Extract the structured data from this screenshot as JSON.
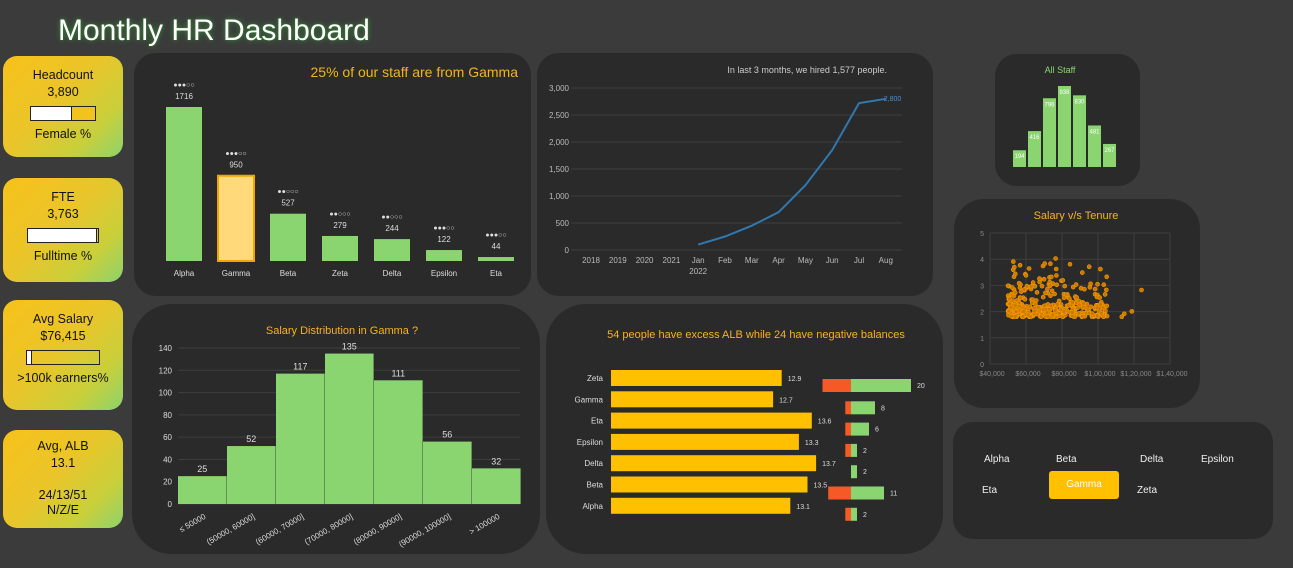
{
  "title": "Monthly HR Dashboard",
  "kpis": {
    "headcount": {
      "label": "Headcount",
      "value": "3,890",
      "sub": "Female %",
      "bar_fraction": 0.62
    },
    "fte": {
      "label": "FTE",
      "value": "3,763",
      "sub": "Fulltime %",
      "bar_fraction": 0.97
    },
    "salary": {
      "label": "Avg Salary",
      "value": "$76,415",
      "sub": ">100k earners%",
      "bar_fraction": 0.06
    },
    "alb": {
      "label": "Avg, ALB",
      "value": "13.1",
      "ratio": "24/13/51",
      "ratio_sub": "N/Z/E"
    }
  },
  "colors": {
    "green": "#8ad56f",
    "yellow": "#ffc000",
    "orange": "#f55a26",
    "highlight": "#ffd97a",
    "panel": "#2a2a2a",
    "blue": "#2f78b0"
  },
  "chart_data": [
    {
      "id": "dept",
      "type": "bar",
      "title": "25% of our staff are from Gamma",
      "categories": [
        "Alpha",
        "Gamma",
        "Beta",
        "Zeta",
        "Delta",
        "Epsilon",
        "Eta"
      ],
      "values": [
        1716,
        950,
        527,
        279,
        244,
        122,
        44
      ],
      "value_labels": [
        "1716",
        "950",
        "527",
        "279",
        "244",
        "122",
        "44"
      ],
      "rating_labels": [
        "●●●○○",
        "●●●○○",
        "●●○○○",
        "●●○○○",
        "●●○○○",
        "●●●○○",
        "●●●○○"
      ],
      "highlight": "Gamma"
    },
    {
      "id": "hires",
      "type": "line",
      "title": "In last 3 months, we hired 1,577 people.",
      "x": [
        "2018",
        "2019",
        "2020",
        "2021",
        "Jan 2022",
        "Feb",
        "Mar",
        "Apr",
        "May",
        "Jun",
        "Jul",
        "Aug"
      ],
      "x_ticks": [
        "2018",
        "2019",
        "2020",
        "2021",
        "Jan",
        "Feb",
        "Mar",
        "Apr",
        "May",
        "Jun",
        "Jul",
        "Aug"
      ],
      "x_sub": "2022",
      "y": [
        null,
        null,
        null,
        null,
        100,
        250,
        450,
        700,
        1200,
        1850,
        2720,
        2800
      ],
      "end_label": "2,800",
      "yticks": [
        "3,000",
        "2,500",
        "2,000",
        "1,500",
        "1,000",
        "500",
        "0"
      ],
      "ylim": [
        0,
        3000
      ]
    },
    {
      "id": "allstaff",
      "type": "bar",
      "title": "All Staff",
      "values": [
        194,
        416,
        796,
        938,
        830,
        481,
        267
      ]
    },
    {
      "id": "scatter",
      "type": "scatter",
      "title": "Salary v/s Tenure",
      "xticks": [
        "$40,000",
        "$60,000",
        "$80,000",
        "$1,00,000",
        "$1,20,000",
        "$1,40,000"
      ],
      "yticks": [
        "5",
        "4",
        "3",
        "2",
        "1",
        "0"
      ],
      "xlim": [
        40000,
        140000
      ],
      "ylim": [
        0,
        5
      ]
    },
    {
      "id": "salarydist",
      "type": "bar",
      "title": "Salary Distribution in Gamma ?",
      "categories": [
        "≤ 50000",
        "(50000, 60000]",
        "(60000, 70000]",
        "(70000, 80000]",
        "(80000, 90000]",
        "(90000, 100000]",
        "> 100000"
      ],
      "values": [
        25,
        52,
        117,
        135,
        111,
        56,
        32
      ],
      "yticks": [
        "140",
        "120",
        "100",
        "80",
        "60",
        "40",
        "20",
        "0"
      ],
      "ylim": [
        0,
        140
      ]
    },
    {
      "id": "alb",
      "type": "bar",
      "title": "54 people have excess ALB while 24 have negative balances",
      "categories": [
        "Zeta",
        "Gamma",
        "Eta",
        "Epsilon",
        "Delta",
        "Beta",
        "Alpha"
      ],
      "values": [
        12.9,
        12.7,
        13.6,
        13.3,
        13.7,
        13.5,
        13.1
      ],
      "excess": [
        20,
        8,
        6,
        2,
        2,
        11,
        2
      ],
      "negative": [
        5,
        1,
        1,
        1,
        0,
        4,
        1
      ]
    }
  ],
  "slicer": {
    "items": [
      "Alpha",
      "Beta",
      "Delta",
      "Epsilon",
      "Eta",
      "Gamma",
      "Zeta"
    ],
    "selected": "Gamma"
  }
}
